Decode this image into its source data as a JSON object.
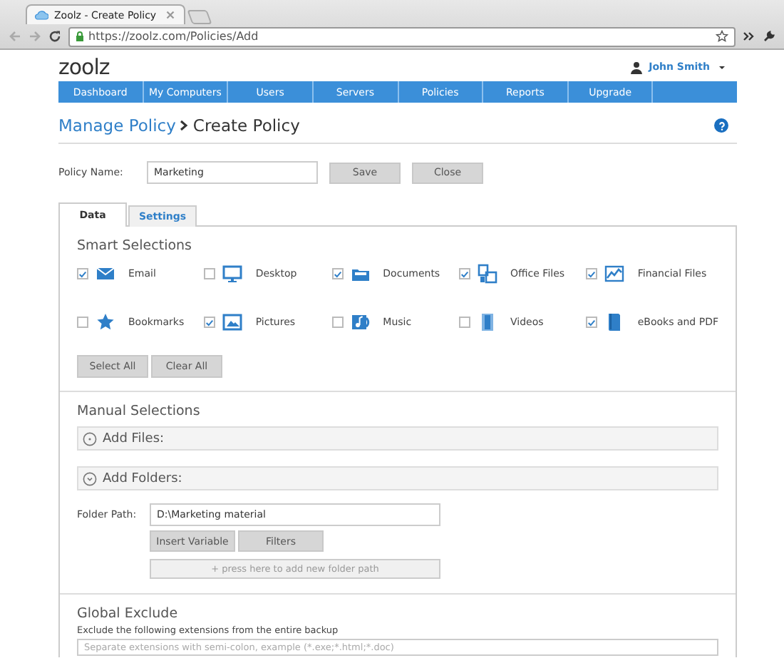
{
  "browser": {
    "tab_title": "Zoolz - Create Policy",
    "url": "https://zoolz.com/Policies/Add"
  },
  "header": {
    "logo": "zoolz",
    "user": "John Smith"
  },
  "nav": [
    {
      "label": "Dashboard"
    },
    {
      "label": "My Computers"
    },
    {
      "label": "Users"
    },
    {
      "label": "Servers"
    },
    {
      "label": "Policies"
    },
    {
      "label": "Reports"
    },
    {
      "label": "Upgrade"
    }
  ],
  "breadcrumb": {
    "parent": "Manage Policy",
    "current": "Create Policy"
  },
  "policy_name": {
    "label": "Policy Name:",
    "value": "Marketing"
  },
  "actions": [
    "Save",
    "Close"
  ],
  "tabs": [
    {
      "label": "Data",
      "selected": true
    },
    {
      "label": "Settings",
      "selected": false
    }
  ],
  "smart_selections": {
    "title": "Smart Selections",
    "items": [
      {
        "label": "Email",
        "checked": true
      },
      {
        "label": "Desktop",
        "checked": false
      },
      {
        "label": "Documents",
        "checked": true
      },
      {
        "label": "Office Files",
        "checked": true
      },
      {
        "label": "Financial Files",
        "checked": true
      },
      {
        "label": "Bookmarks",
        "checked": false
      },
      {
        "label": "Pictures",
        "checked": true
      },
      {
        "label": "Music",
        "checked": false
      },
      {
        "label": "Videos",
        "checked": false
      },
      {
        "label": "eBooks and PDF",
        "checked": true
      }
    ],
    "buttons": [
      "Select All",
      "Clear All"
    ]
  },
  "manual_selections": {
    "title": "Manual Selections",
    "sections": [
      {
        "label": "Add Files:",
        "expanded": false
      },
      {
        "label": "Add Folders:",
        "expanded": true
      }
    ],
    "folder_path": {
      "label": "Folder Path:",
      "value": "D:\\Marketing material"
    },
    "buttons": [
      "Insert Variable",
      "Filters"
    ],
    "add_path": "+ press here to add new folder path"
  },
  "global_exclude": {
    "title": "Global Exclude",
    "description": "Exclude the following extensions from the entire backup",
    "placeholder": "Separate extensions with semi-colon, example (*.exe;*.html;*.doc)"
  }
}
